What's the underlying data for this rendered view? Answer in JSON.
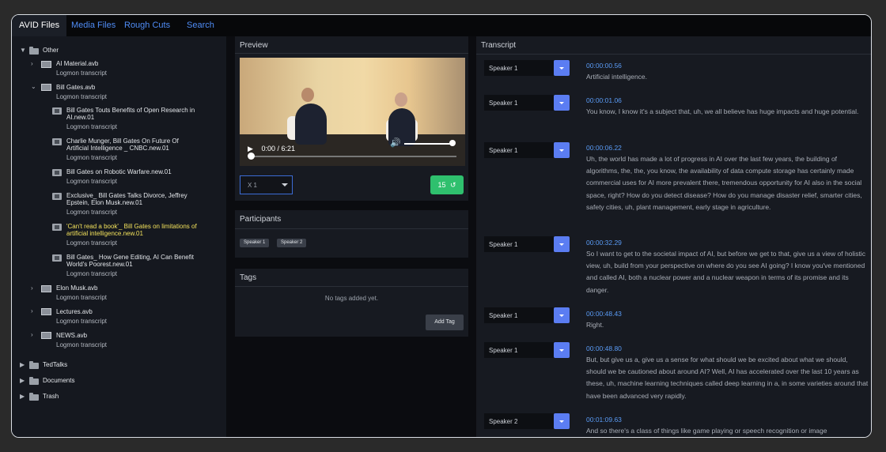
{
  "tabs": [
    "AVID Files",
    "Media Files",
    "Rough Cuts",
    "Search"
  ],
  "sidebar": {
    "root": "Other",
    "items": [
      {
        "name": "AI Material.avb",
        "sub": "Logmon transcript"
      },
      {
        "name": "Bill Gates.avb",
        "sub": "Logmon transcript"
      },
      {
        "line1": "Bill Gates Touts Benefits of Open Research in",
        "line2": "AI.new.01",
        "sub": "Logmon transcript"
      },
      {
        "line1": "Charlie Munger, Bill Gates On Future Of",
        "line2": "Artificial Intelligence _ CNBC.new.01",
        "sub": "Logmon transcript"
      },
      {
        "line1": "Bill Gates on Robotic Warfare.new.01",
        "sub": "Logmon transcript"
      },
      {
        "line1": "Exclusive_ Bill Gates Talks Divorce, Jeffrey",
        "line2": "Epstein, Elon Musk.new.01",
        "sub": "Logmon transcript"
      },
      {
        "line1": "'Can't read a book'_ Bill Gates on limitations of",
        "line2": "artificial intelligence.new.01",
        "sub": "Logmon transcript"
      },
      {
        "line1": "Bill Gates_ How Gene Editing, AI Can Benefit",
        "line2": "World's Poorest.new.01",
        "sub": "Logmon transcript"
      },
      {
        "name": "Elon Musk.avb",
        "sub": "Logmon transcript"
      },
      {
        "name": "Lectures.avb",
        "sub": "Logmon transcript"
      },
      {
        "name": "NEWS.avb",
        "sub": "Logmon transcript"
      }
    ],
    "folders": [
      "TedTalks",
      "Documents",
      "Trash"
    ]
  },
  "preview": {
    "title": "Preview",
    "time": "0:00 / 6:21",
    "speed": "X 1",
    "skip": "15",
    "progress_fraction": 0.0,
    "volume_fraction": 1.0
  },
  "participants": {
    "title": "Participants",
    "list": [
      "Speaker 1",
      "Speaker 2"
    ]
  },
  "tags": {
    "title": "Tags",
    "empty": "No tags added yet.",
    "add_label": "Add Tag"
  },
  "transcript": {
    "title": "Transcript",
    "segments": [
      {
        "speaker": "Speaker 1",
        "time": "00:00:00.56",
        "text": "Artificial intelligence."
      },
      {
        "speaker": "Speaker 1",
        "time": "00:00:01.06",
        "text": "You know, I know it's a subject that, uh, we all believe has huge impacts and huge potential."
      },
      {
        "speaker": "Speaker 1",
        "time": "00:00:06.22",
        "text": "Uh, the world has made a lot of progress in AI over the last few years, the building of algorithms, the, the, you know, the availability of data compute storage has certainly made commercial uses for AI more prevalent there, tremendous opportunity for AI also in the social space, right? How do you detect disease? How do you manage disaster relief, smarter cities, safety cities, uh, plant management, early stage in agriculture."
      },
      {
        "speaker": "Speaker 1",
        "time": "00:00:32.29",
        "text": "So I want to get to the societal impact of AI, but before we get to that, give us a view of holistic view, uh, build from your perspective on where do you see AI going? I know you've mentioned and called AI, both a nuclear power and a nuclear weapon in terms of its promise and its danger."
      },
      {
        "speaker": "Speaker 1",
        "time": "00:00:48.43",
        "text": "Right."
      },
      {
        "speaker": "Speaker 1",
        "time": "00:00:48.80",
        "text": "But, but give us a, give us a sense for what should we be excited about what we should, should we be cautioned about around AI? Well, AI has accelerated over the last 10 years as these, uh, machine learning techniques called deep learning in a, in some varieties around that have been advanced very rapidly."
      },
      {
        "speaker": "Speaker 2",
        "time": "00:01:09.63",
        "text": "And so there's a class of things like game playing or speech recognition or image"
      }
    ]
  }
}
